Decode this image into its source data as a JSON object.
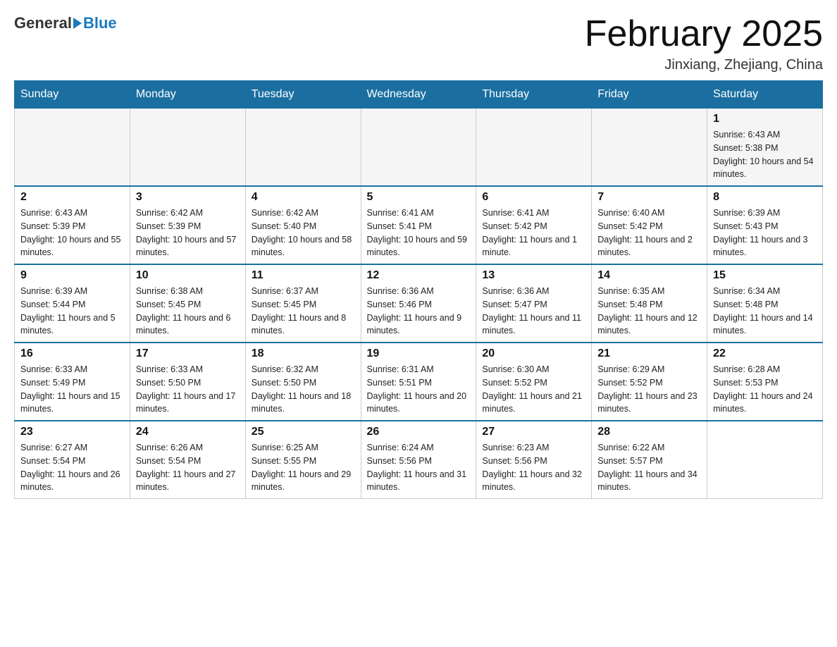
{
  "header": {
    "logo": {
      "part1": "General",
      "part2": "Blue"
    },
    "title": "February 2025",
    "location": "Jinxiang, Zhejiang, China"
  },
  "days_of_week": [
    "Sunday",
    "Monday",
    "Tuesday",
    "Wednesday",
    "Thursday",
    "Friday",
    "Saturday"
  ],
  "weeks": [
    {
      "days": [
        {
          "num": "",
          "sunrise": "",
          "sunset": "",
          "daylight": ""
        },
        {
          "num": "",
          "sunrise": "",
          "sunset": "",
          "daylight": ""
        },
        {
          "num": "",
          "sunrise": "",
          "sunset": "",
          "daylight": ""
        },
        {
          "num": "",
          "sunrise": "",
          "sunset": "",
          "daylight": ""
        },
        {
          "num": "",
          "sunrise": "",
          "sunset": "",
          "daylight": ""
        },
        {
          "num": "",
          "sunrise": "",
          "sunset": "",
          "daylight": ""
        },
        {
          "num": "1",
          "sunrise": "Sunrise: 6:43 AM",
          "sunset": "Sunset: 5:38 PM",
          "daylight": "Daylight: 10 hours and 54 minutes."
        }
      ]
    },
    {
      "days": [
        {
          "num": "2",
          "sunrise": "Sunrise: 6:43 AM",
          "sunset": "Sunset: 5:39 PM",
          "daylight": "Daylight: 10 hours and 55 minutes."
        },
        {
          "num": "3",
          "sunrise": "Sunrise: 6:42 AM",
          "sunset": "Sunset: 5:39 PM",
          "daylight": "Daylight: 10 hours and 57 minutes."
        },
        {
          "num": "4",
          "sunrise": "Sunrise: 6:42 AM",
          "sunset": "Sunset: 5:40 PM",
          "daylight": "Daylight: 10 hours and 58 minutes."
        },
        {
          "num": "5",
          "sunrise": "Sunrise: 6:41 AM",
          "sunset": "Sunset: 5:41 PM",
          "daylight": "Daylight: 10 hours and 59 minutes."
        },
        {
          "num": "6",
          "sunrise": "Sunrise: 6:41 AM",
          "sunset": "Sunset: 5:42 PM",
          "daylight": "Daylight: 11 hours and 1 minute."
        },
        {
          "num": "7",
          "sunrise": "Sunrise: 6:40 AM",
          "sunset": "Sunset: 5:42 PM",
          "daylight": "Daylight: 11 hours and 2 minutes."
        },
        {
          "num": "8",
          "sunrise": "Sunrise: 6:39 AM",
          "sunset": "Sunset: 5:43 PM",
          "daylight": "Daylight: 11 hours and 3 minutes."
        }
      ]
    },
    {
      "days": [
        {
          "num": "9",
          "sunrise": "Sunrise: 6:39 AM",
          "sunset": "Sunset: 5:44 PM",
          "daylight": "Daylight: 11 hours and 5 minutes."
        },
        {
          "num": "10",
          "sunrise": "Sunrise: 6:38 AM",
          "sunset": "Sunset: 5:45 PM",
          "daylight": "Daylight: 11 hours and 6 minutes."
        },
        {
          "num": "11",
          "sunrise": "Sunrise: 6:37 AM",
          "sunset": "Sunset: 5:45 PM",
          "daylight": "Daylight: 11 hours and 8 minutes."
        },
        {
          "num": "12",
          "sunrise": "Sunrise: 6:36 AM",
          "sunset": "Sunset: 5:46 PM",
          "daylight": "Daylight: 11 hours and 9 minutes."
        },
        {
          "num": "13",
          "sunrise": "Sunrise: 6:36 AM",
          "sunset": "Sunset: 5:47 PM",
          "daylight": "Daylight: 11 hours and 11 minutes."
        },
        {
          "num": "14",
          "sunrise": "Sunrise: 6:35 AM",
          "sunset": "Sunset: 5:48 PM",
          "daylight": "Daylight: 11 hours and 12 minutes."
        },
        {
          "num": "15",
          "sunrise": "Sunrise: 6:34 AM",
          "sunset": "Sunset: 5:48 PM",
          "daylight": "Daylight: 11 hours and 14 minutes."
        }
      ]
    },
    {
      "days": [
        {
          "num": "16",
          "sunrise": "Sunrise: 6:33 AM",
          "sunset": "Sunset: 5:49 PM",
          "daylight": "Daylight: 11 hours and 15 minutes."
        },
        {
          "num": "17",
          "sunrise": "Sunrise: 6:33 AM",
          "sunset": "Sunset: 5:50 PM",
          "daylight": "Daylight: 11 hours and 17 minutes."
        },
        {
          "num": "18",
          "sunrise": "Sunrise: 6:32 AM",
          "sunset": "Sunset: 5:50 PM",
          "daylight": "Daylight: 11 hours and 18 minutes."
        },
        {
          "num": "19",
          "sunrise": "Sunrise: 6:31 AM",
          "sunset": "Sunset: 5:51 PM",
          "daylight": "Daylight: 11 hours and 20 minutes."
        },
        {
          "num": "20",
          "sunrise": "Sunrise: 6:30 AM",
          "sunset": "Sunset: 5:52 PM",
          "daylight": "Daylight: 11 hours and 21 minutes."
        },
        {
          "num": "21",
          "sunrise": "Sunrise: 6:29 AM",
          "sunset": "Sunset: 5:52 PM",
          "daylight": "Daylight: 11 hours and 23 minutes."
        },
        {
          "num": "22",
          "sunrise": "Sunrise: 6:28 AM",
          "sunset": "Sunset: 5:53 PM",
          "daylight": "Daylight: 11 hours and 24 minutes."
        }
      ]
    },
    {
      "days": [
        {
          "num": "23",
          "sunrise": "Sunrise: 6:27 AM",
          "sunset": "Sunset: 5:54 PM",
          "daylight": "Daylight: 11 hours and 26 minutes."
        },
        {
          "num": "24",
          "sunrise": "Sunrise: 6:26 AM",
          "sunset": "Sunset: 5:54 PM",
          "daylight": "Daylight: 11 hours and 27 minutes."
        },
        {
          "num": "25",
          "sunrise": "Sunrise: 6:25 AM",
          "sunset": "Sunset: 5:55 PM",
          "daylight": "Daylight: 11 hours and 29 minutes."
        },
        {
          "num": "26",
          "sunrise": "Sunrise: 6:24 AM",
          "sunset": "Sunset: 5:56 PM",
          "daylight": "Daylight: 11 hours and 31 minutes."
        },
        {
          "num": "27",
          "sunrise": "Sunrise: 6:23 AM",
          "sunset": "Sunset: 5:56 PM",
          "daylight": "Daylight: 11 hours and 32 minutes."
        },
        {
          "num": "28",
          "sunrise": "Sunrise: 6:22 AM",
          "sunset": "Sunset: 5:57 PM",
          "daylight": "Daylight: 11 hours and 34 minutes."
        },
        {
          "num": "",
          "sunrise": "",
          "sunset": "",
          "daylight": ""
        }
      ]
    }
  ]
}
